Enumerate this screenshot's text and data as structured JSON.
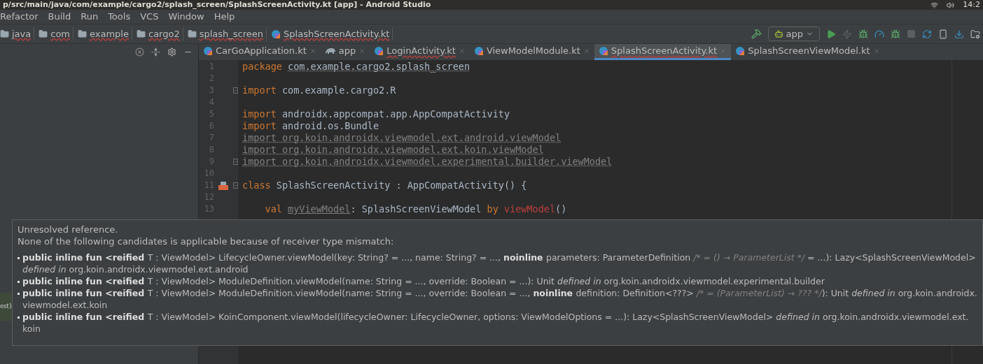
{
  "window": {
    "title": "p/src/main/java/com/example/cargo2/splash_screen/SplashScreenActivity.kt [app] - Android Studio",
    "clock": "14:2"
  },
  "menu": [
    "Refactor",
    "Build",
    "Run",
    "Tools",
    "VCS",
    "Window",
    "Help"
  ],
  "breadcrumbs": [
    {
      "kind": "folder",
      "label": "java"
    },
    {
      "kind": "folder",
      "label": "com"
    },
    {
      "kind": "folder",
      "label": "example"
    },
    {
      "kind": "folder",
      "label": "cargo2"
    },
    {
      "kind": "folder",
      "label": "splash_screen"
    },
    {
      "kind": "kotlin",
      "label": "SplashScreenActivity.kt"
    }
  ],
  "run_config": {
    "label": "app"
  },
  "tabs": [
    {
      "kind": "kotlin",
      "label": "CarGoApplication.kt",
      "selected": false,
      "error": false
    },
    {
      "kind": "gradle",
      "label": "app",
      "selected": false,
      "error": false
    },
    {
      "kind": "kotlin",
      "label": "LoginActivity.kt",
      "selected": false,
      "error": true
    },
    {
      "kind": "kotlin",
      "label": "ViewModelModule.kt",
      "selected": false,
      "error": false
    },
    {
      "kind": "kotlin",
      "label": "SplashScreenActivity.kt",
      "selected": true,
      "error": true
    },
    {
      "kind": "kotlin",
      "label": "SplashScreenViewModel.kt",
      "selected": false,
      "error": false
    }
  ],
  "side_panel": {
    "snippet": "est}"
  },
  "code": [
    {
      "number": "1",
      "fold": false,
      "gutter_icon": false,
      "segments": [
        {
          "kind": "kw",
          "text": "package "
        },
        {
          "kind": "underlined",
          "text": "com.example.cargo2.splash_screen"
        }
      ]
    },
    {
      "number": "2",
      "fold": false,
      "gutter_icon": false
    },
    {
      "number": "3",
      "fold": true,
      "gutter_icon": false,
      "segments": [
        {
          "kind": "kw",
          "text": "import "
        },
        {
          "kind": "plain",
          "text": "com.example.cargo2.R"
        }
      ]
    },
    {
      "number": "4",
      "fold": false,
      "gutter_icon": false
    },
    {
      "number": "5",
      "fold": false,
      "gutter_icon": false,
      "segments": [
        {
          "kind": "kw",
          "text": "import "
        },
        {
          "kind": "plain",
          "text": "androidx.appcompat.app.AppCompatActivity"
        }
      ]
    },
    {
      "number": "6",
      "fold": false,
      "gutter_icon": false,
      "segments": [
        {
          "kind": "kw",
          "text": "import "
        },
        {
          "kind": "plain",
          "text": "android.os.Bundle"
        }
      ]
    },
    {
      "number": "7",
      "fold": false,
      "gutter_icon": false,
      "segments": [
        {
          "kind": "unused",
          "text": "import org.koin.androidx.viewmodel.ext.android.viewModel"
        }
      ]
    },
    {
      "number": "8",
      "fold": false,
      "gutter_icon": false,
      "segments": [
        {
          "kind": "unused",
          "text": "import org.koin.androidx.viewmodel.ext.koin.viewModel"
        }
      ]
    },
    {
      "number": "9",
      "fold": true,
      "gutter_icon": false,
      "segments": [
        {
          "kind": "unused",
          "text": "import org.koin.androidx.viewmodel.experimental.builder.viewModel"
        }
      ]
    },
    {
      "number": "10",
      "fold": false,
      "gutter_icon": false
    },
    {
      "number": "11",
      "fold": true,
      "gutter_icon": true,
      "segments": [
        {
          "kind": "kw",
          "text": "class "
        },
        {
          "kind": "plain",
          "text": "SplashScreenActivity : AppCompatActivity"
        },
        {
          "kind": "paren",
          "text": "()"
        },
        {
          "kind": "plain",
          "text": " {"
        }
      ]
    },
    {
      "number": "12",
      "fold": false,
      "gutter_icon": false
    },
    {
      "number": "13",
      "fold": false,
      "gutter_icon": false,
      "segments": [
        {
          "kind": "kw",
          "text": "    val "
        },
        {
          "kind": "warn",
          "text": "myViewModel"
        },
        {
          "kind": "plain",
          "text": ": SplashScreenViewModel "
        },
        {
          "kind": "kw",
          "text": "by "
        },
        {
          "kind": "error",
          "text": "viewModel"
        },
        {
          "kind": "plain",
          "text": "()"
        }
      ]
    }
  ],
  "tooltip": {
    "title": "Unresolved reference.",
    "subtitle": "None of the following candidates is applicable because of receiver type mismatch:",
    "items": [
      [
        {
          "kind": "bold",
          "text": "public inline fun <reified "
        },
        {
          "kind": "plain",
          "text": "T : ViewModel> LifecycleOwner.viewModel(key: String? = ..., name: String? = ..., "
        },
        {
          "kind": "bold",
          "text": "noinline "
        },
        {
          "kind": "plain",
          "text": "parameters: ParameterDefinition "
        },
        {
          "kind": "comment",
          "text": "/* = () → ParameterList */"
        },
        {
          "kind": "plain",
          "text": " = ...): Lazy<SplashScreenViewModel> "
        },
        {
          "kind": "italic",
          "text": "defined in "
        },
        {
          "kind": "plain",
          "text": "org.koin.androidx.viewmodel.ext.android"
        }
      ],
      [
        {
          "kind": "bold",
          "text": "public inline fun <reified "
        },
        {
          "kind": "plain",
          "text": "T : ViewModel> ModuleDefinition.viewModel(name: String = ..., override: Boolean = ...): Unit "
        },
        {
          "kind": "italic",
          "text": "defined in "
        },
        {
          "kind": "plain",
          "text": "org.koin.androidx.viewmodel.experimental.builder"
        }
      ],
      [
        {
          "kind": "bold",
          "text": "public inline fun <reified "
        },
        {
          "kind": "plain",
          "text": "T : ViewModel> ModuleDefinition.viewModel(name: String = ..., override: Boolean = ..., "
        },
        {
          "kind": "bold",
          "text": "noinline "
        },
        {
          "kind": "plain",
          "text": "definition: Definition<???> "
        },
        {
          "kind": "comment",
          "text": "/* = (ParameterList) → ??? */"
        },
        {
          "kind": "plain",
          "text": "): Unit "
        },
        {
          "kind": "italic",
          "text": "defined in "
        },
        {
          "kind": "plain",
          "text": "org.koin.androidx. viewmodel.ext.koin"
        }
      ],
      [
        {
          "kind": "bold",
          "text": "public inline fun <reified "
        },
        {
          "kind": "plain",
          "text": "T : ViewModel> KoinComponent.viewModel(lifecycleOwner: LifecycleOwner, options: ViewModelOptions = ...): Lazy<SplashScreenViewModel> "
        },
        {
          "kind": "italic",
          "text": "defined in "
        },
        {
          "kind": "plain",
          "text": "org.koin.androidx.viewmodel.ext. koin"
        }
      ]
    ]
  }
}
